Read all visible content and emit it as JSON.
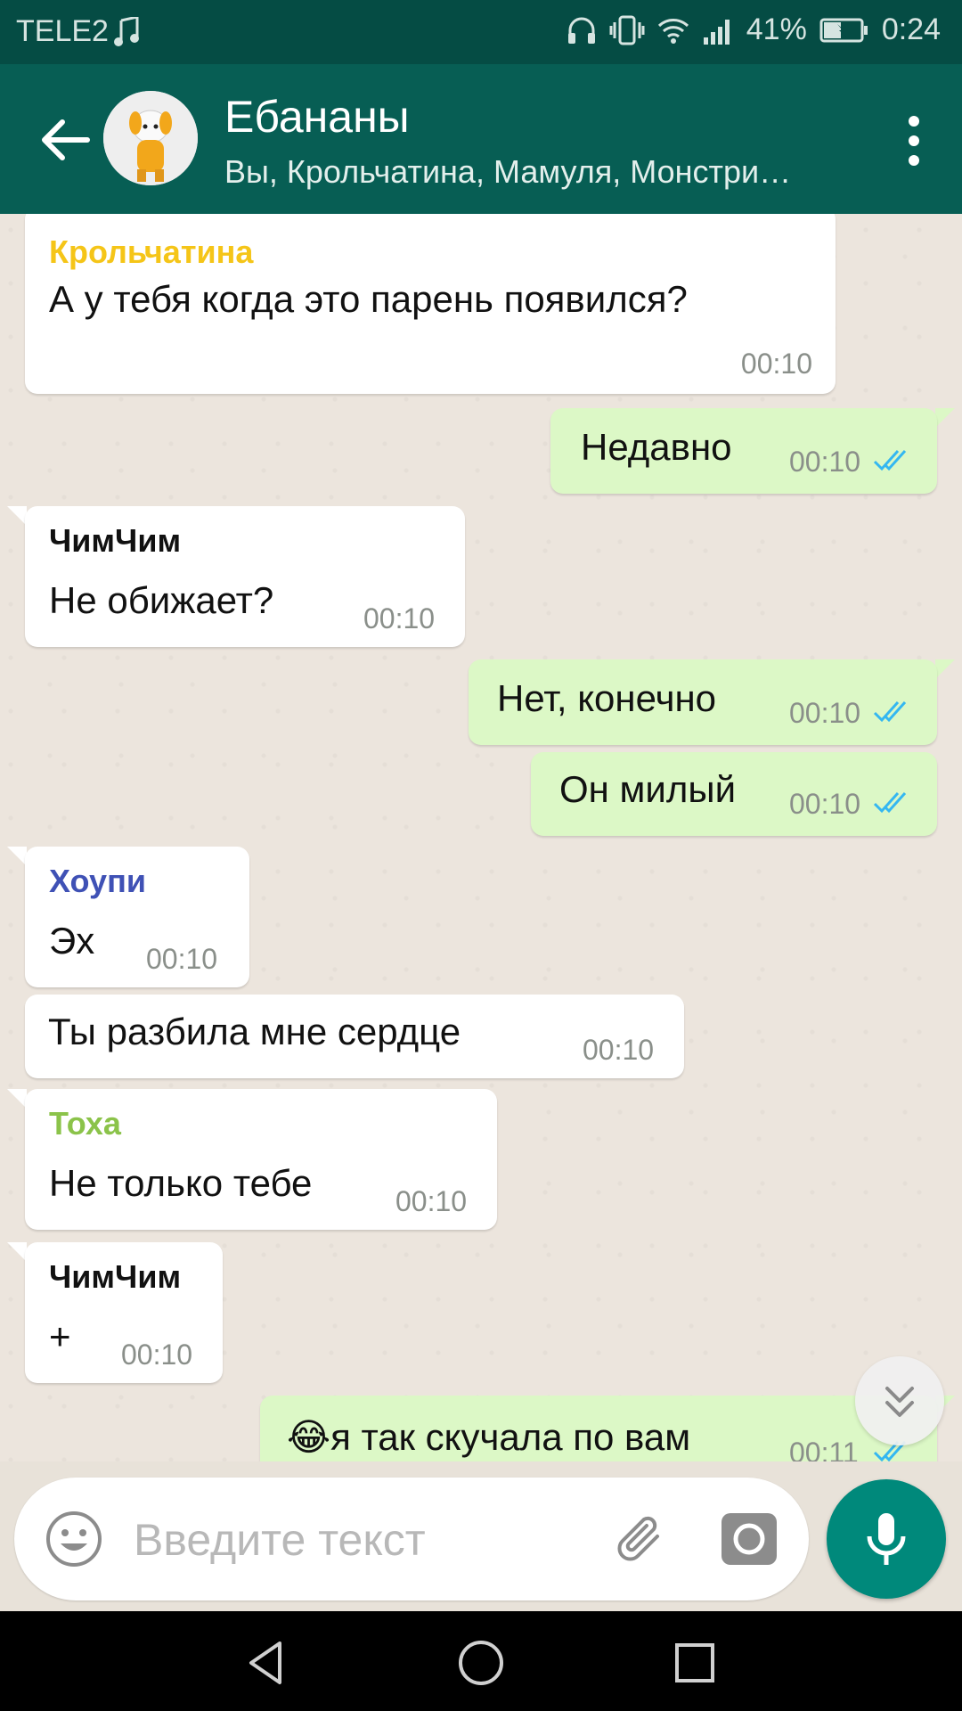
{
  "status_bar": {
    "carrier": "TELE2",
    "battery": "41%",
    "time": "0:24"
  },
  "header": {
    "title": "Ебананы",
    "subtitle": "Вы, Крольчатина, Мамуля, Монстри…"
  },
  "messages": [
    {
      "sender": "Крольчатина",
      "sender_color": "#f5c518",
      "text": "А у тебя когда это парень появился?",
      "time": "00:10",
      "direction": "in"
    },
    {
      "text": "Недавно",
      "time": "00:10",
      "direction": "out"
    },
    {
      "sender": "ЧимЧим",
      "sender_color": "#111111",
      "text": "Не обижает?",
      "time": "00:10",
      "direction": "in"
    },
    {
      "text": "Нет, конечно",
      "time": "00:10",
      "direction": "out"
    },
    {
      "text": "Он милый",
      "time": "00:10",
      "direction": "out"
    },
    {
      "sender": "Хоупи",
      "sender_color": "#3f51b5",
      "text": "Эх",
      "time": "00:10",
      "direction": "in"
    },
    {
      "text": "Ты разбила мне сердце",
      "time": "00:10",
      "direction": "in"
    },
    {
      "sender": "Тоха",
      "sender_color": "#8bc34a",
      "text": "Не только тебе",
      "time": "00:10",
      "direction": "in"
    },
    {
      "sender": "ЧимЧим",
      "sender_color": "#111111",
      "text": "+",
      "time": "00:10",
      "direction": "in"
    },
    {
      "text": "я так скучала по вам",
      "emoji": "😂",
      "time": "00:11",
      "direction": "out"
    }
  ],
  "input": {
    "placeholder": "Введите текст"
  },
  "colors": {
    "header": "#075e54",
    "status_bar": "#054c44",
    "outgoing_bubble": "#dcf8c6",
    "read_ticks": "#34b7f1",
    "mic_button": "#00897b"
  },
  "icons": [
    "back-arrow-icon",
    "more-vert-icon",
    "emoji-icon",
    "paperclip-icon",
    "camera-icon",
    "mic-icon",
    "double-chevron-down-icon",
    "nav-back-icon",
    "nav-home-icon",
    "nav-recents-icon"
  ]
}
